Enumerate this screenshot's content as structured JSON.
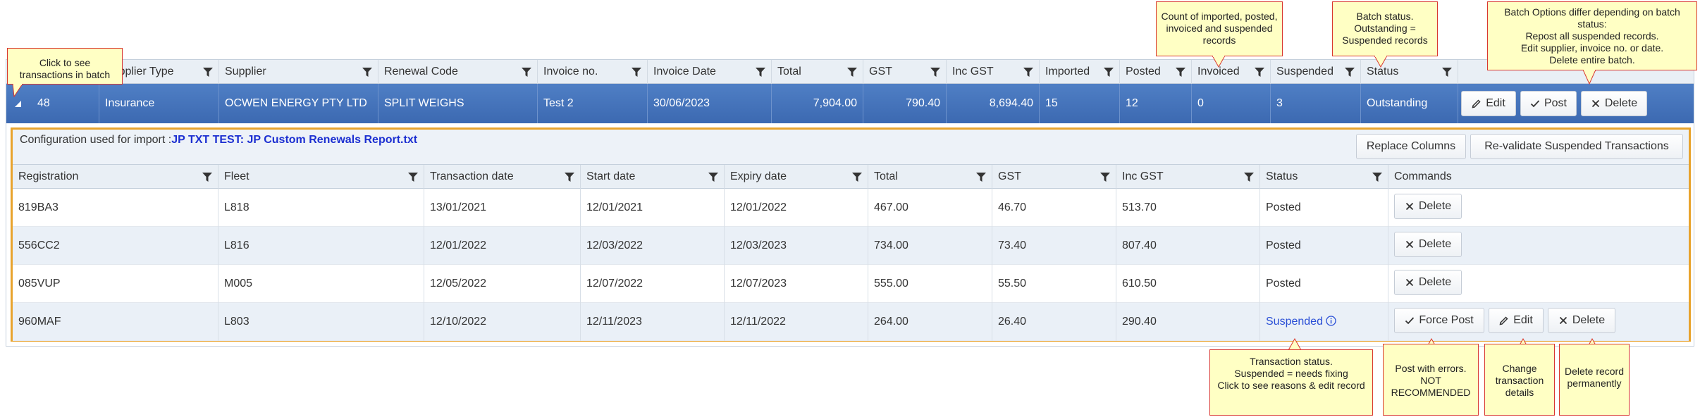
{
  "batch_grid": {
    "columns": [
      "",
      "Supplier Type",
      "Supplier",
      "Renewal Code",
      "Invoice no.",
      "Invoice Date",
      "Total",
      "GST",
      "Inc GST",
      "Imported",
      "Posted",
      "Invoiced",
      "Suspended",
      "Status"
    ],
    "row": {
      "id": "48",
      "supplier_type": "Insurance",
      "supplier": "OCWEN ENERGY PTY LTD",
      "renewal_code": "SPLIT WEIGHS",
      "invoice_no": "Test 2",
      "invoice_date": "30/06/2023",
      "total": "7,904.00",
      "gst": "790.40",
      "inc_gst": "8,694.40",
      "imported": "15",
      "posted": "12",
      "invoiced": "0",
      "suspended": "3",
      "status": "Outstanding"
    },
    "buttons": {
      "edit": "Edit",
      "post": "Post",
      "delete": "Delete"
    }
  },
  "detail": {
    "config_label": "Configuration used for import :",
    "config_file": "JP TXT TEST: JP Custom Renewals Report.txt",
    "replace_columns": "Replace Columns",
    "revalidate": "Re-validate Suspended Transactions",
    "columns": [
      "Registration",
      "Fleet",
      "Transaction date",
      "Start date",
      "Expiry date",
      "Total",
      "GST",
      "Inc GST",
      "Status",
      "Commands"
    ],
    "rows": [
      {
        "registration": "819BA3",
        "fleet": "L818",
        "transaction_date": "13/01/2021",
        "start_date": "12/01/2021",
        "expiry_date": "12/01/2022",
        "total": "467.00",
        "gst": "46.70",
        "inc_gst": "513.70",
        "status": "Posted"
      },
      {
        "registration": "556CC2",
        "fleet": "L816",
        "transaction_date": "12/01/2022",
        "start_date": "12/03/2022",
        "expiry_date": "12/03/2023",
        "total": "734.00",
        "gst": "73.40",
        "inc_gst": "807.40",
        "status": "Posted"
      },
      {
        "registration": "085VUP",
        "fleet": "M005",
        "transaction_date": "12/05/2022",
        "start_date": "12/07/2022",
        "expiry_date": "12/07/2023",
        "total": "555.00",
        "gst": "55.50",
        "inc_gst": "610.50",
        "status": "Posted"
      },
      {
        "registration": "960MAF",
        "fleet": "L803",
        "transaction_date": "12/10/2022",
        "start_date": "12/11/2023",
        "expiry_date": "12/11/2022",
        "total": "264.00",
        "gst": "26.40",
        "inc_gst": "290.40",
        "status": "Suspended"
      }
    ],
    "buttons": {
      "delete": "Delete",
      "force_post": "Force Post",
      "edit": "Edit"
    }
  },
  "callouts": {
    "expand": "Click to see transactions in batch",
    "counts": "Count of imported, posted, invoiced and suspended records",
    "status": "Batch status. Outstanding = Suspended records",
    "options": "Batch Options differ depending on batch status:\nRepost all suspended records.\nEdit supplier, invoice no. or date.\nDelete entire batch.",
    "txn_status": "Transaction status.\nSuspended = needs fixing\nClick to see reasons & edit record",
    "force_post": "Post with errors.\nNOT RECOMMENDED",
    "edit": "Change transaction details",
    "delete": "Delete record permanently"
  },
  "colors": {
    "master_row": "#3c69b1",
    "detail_border": "#e8a32d",
    "callout_bg": "#ffffc4",
    "callout_border": "#d9382e",
    "link": "#2a4fd6"
  }
}
